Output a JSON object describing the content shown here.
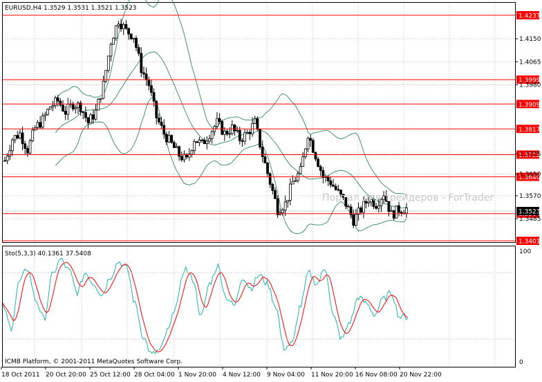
{
  "header": {
    "main": "EURUSD,H4  1.3529 1.3531 1.3521 1.3523",
    "osc": "Sto(5,3,3) 40.1361 37.5408"
  },
  "watermark": "Портал для трейдеров - ForTrader",
  "copyright": "ICMB Platform, © 2001-2011 MetaQuotes Software Corp.",
  "price_axis": {
    "ticks": [
      "1.4150",
      "1.4065",
      "1.3980",
      "1.3725",
      "1.3650",
      "1.3570",
      "1.3485"
    ],
    "current": "1.3523"
  },
  "levels": [
    "1.4237",
    "1.3999",
    "1.3909",
    "1.3817",
    "1.3722",
    "1.3640",
    "1.3504",
    "1.3401"
  ],
  "osc_axis": {
    "top": "100",
    "bottom": "0"
  },
  "time_axis": [
    "18 Oct 2011",
    "20 Oct 20:00",
    "25 Oct 12:00",
    "28 Oct 04:00",
    "1 Nov 20:00",
    "4 Nov 12:00",
    "9 Nov 04:00",
    "11 Nov 20:00",
    "16 Nov 08:00",
    "20 Nov 22:00"
  ],
  "colors": {
    "background": "#ffffff",
    "grid": "#c0c0c0",
    "candles": "#000000",
    "bands": "#2e8b57",
    "levels": "#ff0000",
    "stoch_main": "#20b2aa",
    "stoch_signal": "#ff0000",
    "level_label_bg": "#ff0000",
    "level_label_text": "#ffffff"
  },
  "chart_data": [
    {
      "type": "candlestick",
      "series": [
        {
          "name": "EURUSD,H4"
        }
      ],
      "x": [
        "18 Oct 2011",
        "20 Oct 20:00",
        "25 Oct 12:00",
        "28 Oct 04:00",
        "1 Nov 20:00",
        "4 Nov 12:00",
        "9 Nov 04:00",
        "11 Nov 20:00",
        "16 Nov 08:00",
        "20 Nov 22:00"
      ],
      "close_path": [
        1.37,
        1.378,
        1.38,
        1.374,
        1.382,
        1.385,
        1.39,
        1.392,
        1.388,
        1.391,
        1.39,
        1.384,
        1.388,
        1.398,
        1.414,
        1.422,
        1.418,
        1.416,
        1.404,
        1.398,
        1.386,
        1.38,
        1.376,
        1.372,
        1.37,
        1.378,
        1.376,
        1.38,
        1.384,
        1.38,
        1.382,
        1.378,
        1.38,
        1.384,
        1.372,
        1.362,
        1.352,
        1.354,
        1.362,
        1.366,
        1.38,
        1.372,
        1.364,
        1.362,
        1.358,
        1.354,
        1.348,
        1.352,
        1.356,
        1.354,
        1.358,
        1.35,
        1.352,
        1.3523
      ],
      "ylim": [
        1.3401,
        1.4237
      ],
      "yticks": [
        1.415,
        1.4065,
        1.398,
        1.3725,
        1.365,
        1.357,
        1.3485
      ],
      "levels": [
        1.4237,
        1.3999,
        1.3909,
        1.3817,
        1.3722,
        1.364,
        1.3504,
        1.3401
      ],
      "last": 1.3523
    },
    {
      "type": "line",
      "series": [
        {
          "name": "Sto(5,3,3)",
          "main": 40.1361,
          "signal": 37.5408
        }
      ],
      "main_path": [
        50,
        30,
        72,
        84,
        55,
        38,
        78,
        92,
        82,
        62,
        80,
        70,
        60,
        76,
        90,
        84,
        52,
        22,
        6,
        10,
        28,
        52,
        84,
        74,
        40,
        70,
        86,
        58,
        50,
        76,
        66,
        78,
        70,
        50,
        12,
        16,
        50,
        80,
        70,
        84,
        40,
        20,
        36,
        58,
        52,
        42,
        56,
        62,
        40,
        40
      ],
      "ylim": [
        0,
        100
      ]
    }
  ]
}
